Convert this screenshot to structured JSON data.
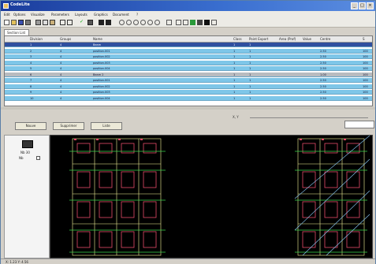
{
  "window": {
    "title": "CodeLite"
  },
  "menubar": {
    "items": [
      "Edit",
      "Options",
      "Visualize",
      "Parameters",
      "Layouts",
      "Graphics",
      "Document",
      "?"
    ]
  },
  "toolbar": {
    "icons": [
      "new-icon",
      "open-icon",
      "save-icon",
      "print-icon",
      "cut-icon",
      "copy-icon",
      "paste-icon",
      "undo-icon",
      "redo-icon",
      "check-icon",
      "pen-icon",
      "zoom-in-icon",
      "zoom-out-icon",
      "zoom-fit-icon",
      "grid-icon",
      "layers-icon",
      "help-icon"
    ]
  },
  "tab": {
    "label": "Section List"
  },
  "grid": {
    "headers": [
      "",
      "Division",
      "Groups",
      "Name",
      "Class",
      "Point Export",
      "Area (Prof)",
      "Value",
      "Centre",
      "S"
    ],
    "rows": [
      {
        "style": "sel",
        "cells": [
          "",
          "1",
          "4",
          "Beam",
          "1",
          "1",
          "",
          "",
          "",
          ""
        ]
      },
      {
        "style": "blue",
        "cells": [
          "",
          "2",
          "4",
          "position.001",
          "1",
          "1",
          "",
          "",
          "2.50",
          "100"
        ]
      },
      {
        "style": "blue",
        "cells": [
          "",
          "3",
          "4",
          "position.002",
          "1",
          "1",
          "",
          "",
          "2.50",
          "100"
        ]
      },
      {
        "style": "blue",
        "cells": [
          "",
          "4",
          "4",
          "position.003",
          "1",
          "1",
          "",
          "",
          "2.50",
          "100"
        ]
      },
      {
        "style": "blue",
        "cells": [
          "",
          "5",
          "4",
          "position.004",
          "1",
          "1",
          "",
          "",
          "2.50",
          "100"
        ]
      },
      {
        "style": "grey",
        "cells": [
          "",
          "6",
          "4",
          "Beam 2",
          "1",
          "1",
          "",
          "",
          "1.00",
          "100"
        ]
      },
      {
        "style": "blue",
        "cells": [
          "",
          "7",
          "4",
          "position.001",
          "1",
          "1",
          "",
          "",
          "2.50",
          "100"
        ]
      },
      {
        "style": "blue",
        "cells": [
          "",
          "8",
          "4",
          "position.002",
          "1",
          "1",
          "",
          "",
          "2.50",
          "100"
        ]
      },
      {
        "style": "blue",
        "cells": [
          "",
          "9",
          "4",
          "position.003",
          "1",
          "1",
          "",
          "",
          "2.50",
          "100"
        ]
      },
      {
        "style": "blue",
        "cells": [
          "",
          "10",
          "4",
          "position.004",
          "1",
          "1",
          "",
          "",
          "2.50",
          "100"
        ]
      }
    ]
  },
  "buttons": {
    "b1": "Nouve",
    "b2": "Supprimer",
    "b3": "Liste"
  },
  "value_label": "X, Y",
  "left_panel": {
    "label1": "Nb 30",
    "label2": "Nb"
  },
  "status": {
    "text": "X: 1.23  Y: 4.56"
  }
}
